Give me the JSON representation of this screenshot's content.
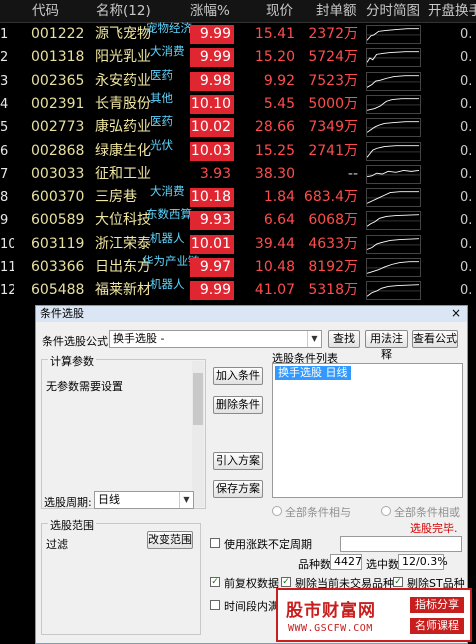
{
  "columns": {
    "code": "代码",
    "name": "名称(12)",
    "change": "涨幅%",
    "price": "现价",
    "sealed": "封单额",
    "chart": "分时简图",
    "open": "开盘换手"
  },
  "rows": [
    {
      "idx": "1",
      "code": "001222",
      "name": "源飞宠物",
      "tag": "宠物经济",
      "change": "9.99",
      "price": "15.41",
      "sealed": "2372万",
      "open": "0.",
      "limit": true,
      "spark": [
        [
          0,
          16
        ],
        [
          4,
          11
        ],
        [
          7,
          10
        ],
        [
          12,
          6
        ],
        [
          20,
          5
        ],
        [
          30,
          4
        ],
        [
          42,
          3
        ],
        [
          54,
          3
        ]
      ]
    },
    {
      "idx": "2",
      "code": "001318",
      "name": "阳光乳业",
      "tag": "大消费",
      "change": "9.99",
      "price": "15.20",
      "sealed": "5724万",
      "open": "0.",
      "limit": true,
      "spark": [
        [
          0,
          15
        ],
        [
          3,
          10
        ],
        [
          6,
          12
        ],
        [
          10,
          6
        ],
        [
          16,
          5
        ],
        [
          24,
          4
        ],
        [
          40,
          3
        ],
        [
          54,
          3
        ]
      ]
    },
    {
      "idx": "3",
      "code": "002365",
      "name": "永安药业",
      "tag": "医药",
      "change": "9.98",
      "price": "9.92",
      "sealed": "7523万",
      "open": "0.",
      "limit": true,
      "spark": [
        [
          0,
          16
        ],
        [
          5,
          13
        ],
        [
          9,
          9
        ],
        [
          14,
          8
        ],
        [
          20,
          6
        ],
        [
          28,
          4
        ],
        [
          40,
          3
        ],
        [
          54,
          3
        ]
      ]
    },
    {
      "idx": "4",
      "code": "002391",
      "name": "长青股份",
      "tag": "其他",
      "change": "10.10",
      "price": "5.45",
      "sealed": "5000万",
      "open": "0.",
      "limit": true,
      "spark": [
        [
          0,
          16
        ],
        [
          8,
          14
        ],
        [
          14,
          11
        ],
        [
          20,
          6
        ],
        [
          26,
          4
        ],
        [
          36,
          3
        ],
        [
          54,
          3
        ]
      ]
    },
    {
      "idx": "5",
      "code": "002773",
      "name": "康弘药业",
      "tag": "医药",
      "change": "10.02",
      "price": "28.66",
      "sealed": "7349万",
      "open": "0.",
      "limit": true,
      "spark": [
        [
          0,
          15
        ],
        [
          4,
          12
        ],
        [
          8,
          9
        ],
        [
          12,
          7
        ],
        [
          18,
          5
        ],
        [
          28,
          4
        ],
        [
          40,
          3
        ],
        [
          54,
          3
        ]
      ]
    },
    {
      "idx": "6",
      "code": "002868",
      "name": "绿康生化",
      "tag": "光伏",
      "change": "10.03",
      "price": "15.25",
      "sealed": "2741万",
      "open": "0.",
      "limit": true,
      "spark": [
        [
          0,
          16
        ],
        [
          3,
          12
        ],
        [
          6,
          8
        ],
        [
          10,
          6
        ],
        [
          18,
          4
        ],
        [
          30,
          3
        ],
        [
          54,
          3
        ]
      ]
    },
    {
      "idx": "7",
      "code": "003033",
      "name": "征和工业",
      "tag": "",
      "change": "3.93",
      "price": "38.30",
      "sealed": "--",
      "open": "0.",
      "limit": false,
      "spark": [
        [
          0,
          12
        ],
        [
          5,
          11
        ],
        [
          10,
          8
        ],
        [
          16,
          9
        ],
        [
          22,
          6
        ],
        [
          30,
          7
        ],
        [
          38,
          5
        ],
        [
          46,
          6
        ],
        [
          54,
          5
        ]
      ]
    },
    {
      "idx": "8",
      "code": "600370",
      "name": "三房巷",
      "tag": "大消费",
      "change": "10.18",
      "price": "1.84",
      "sealed": "683.4万",
      "open": "0.",
      "limit": true,
      "spark": [
        [
          0,
          16
        ],
        [
          6,
          13
        ],
        [
          12,
          10
        ],
        [
          18,
          7
        ],
        [
          24,
          4
        ],
        [
          34,
          3
        ],
        [
          54,
          3
        ]
      ]
    },
    {
      "idx": "9",
      "code": "600589",
      "name": "大位科技",
      "tag": "东数西算",
      "change": "9.93",
      "price": "6.64",
      "sealed": "6068万",
      "open": "0.",
      "limit": true,
      "spark": [
        [
          0,
          16
        ],
        [
          4,
          13
        ],
        [
          8,
          11
        ],
        [
          13,
          7
        ],
        [
          20,
          5
        ],
        [
          30,
          4
        ],
        [
          54,
          3
        ]
      ]
    },
    {
      "idx": "10",
      "code": "603119",
      "name": "浙江荣泰",
      "tag": "机器人",
      "change": "10.01",
      "price": "39.44",
      "sealed": "4633万",
      "open": "0.",
      "limit": true,
      "spark": [
        [
          0,
          15
        ],
        [
          5,
          13
        ],
        [
          10,
          9
        ],
        [
          16,
          7
        ],
        [
          24,
          5
        ],
        [
          34,
          4
        ],
        [
          54,
          3
        ]
      ]
    },
    {
      "idx": "11",
      "code": "603366",
      "name": "日出东方",
      "tag": "华为产业链",
      "change": "9.97",
      "price": "10.48",
      "sealed": "8192万",
      "open": "0.",
      "limit": true,
      "spark": [
        [
          0,
          16
        ],
        [
          6,
          14
        ],
        [
          12,
          12
        ],
        [
          18,
          9
        ],
        [
          26,
          6
        ],
        [
          34,
          4
        ],
        [
          44,
          3
        ],
        [
          54,
          3
        ]
      ]
    },
    {
      "idx": "12",
      "code": "605488",
      "name": "福莱新材",
      "tag": "机器人",
      "change": "9.99",
      "price": "41.07",
      "sealed": "5318万",
      "open": "0.",
      "limit": true,
      "spark": [
        [
          0,
          16
        ],
        [
          5,
          12
        ],
        [
          10,
          10
        ],
        [
          15,
          7
        ],
        [
          22,
          5
        ],
        [
          32,
          4
        ],
        [
          54,
          3
        ]
      ]
    }
  ],
  "dialog": {
    "title": "条件选股",
    "close": "×",
    "formula_label": "条件选股公式",
    "formula_value": "换手选股  -",
    "find": "查找",
    "usage": "用法注释",
    "view": "查看公式",
    "params_group": "计算参数",
    "params_text": "无参数需要设置",
    "add": "加入条件",
    "remove": "删除条件",
    "list_label": "选股条件列表",
    "list_item": "换手选股  日线",
    "import": "引入方案",
    "save": "保存方案",
    "period_label": "选股周期:",
    "period_value": "日线",
    "radio_and": "全部条件相与",
    "radio_or": "全部条件相或",
    "done": "选股完毕.",
    "scope_group": "选股范围",
    "scope_text": "过滤",
    "change_scope": "改变范围",
    "use_period": "使用涨跌不定周期",
    "count_label": "品种数",
    "count_value": "4427",
    "selected_label": "选中数",
    "selected_value": "12/0.3%",
    "chk_prior": "前复权数据",
    "chk_notrade": "剔除当前未交易品种",
    "chk_st": "剔除ST品种",
    "chk_time": "时间段内满足"
  },
  "watermark": {
    "logo": "股市财富网",
    "url": "WWW.GSCFW.COM",
    "right1": "指标分享",
    "right2": "名师课程"
  },
  "colors": {
    "limit_up_bg": "#e02631",
    "quote_red": "#ff4d4d",
    "tag_cyan": "#5fd6ff",
    "code_yellow": "#e8e0a0"
  }
}
